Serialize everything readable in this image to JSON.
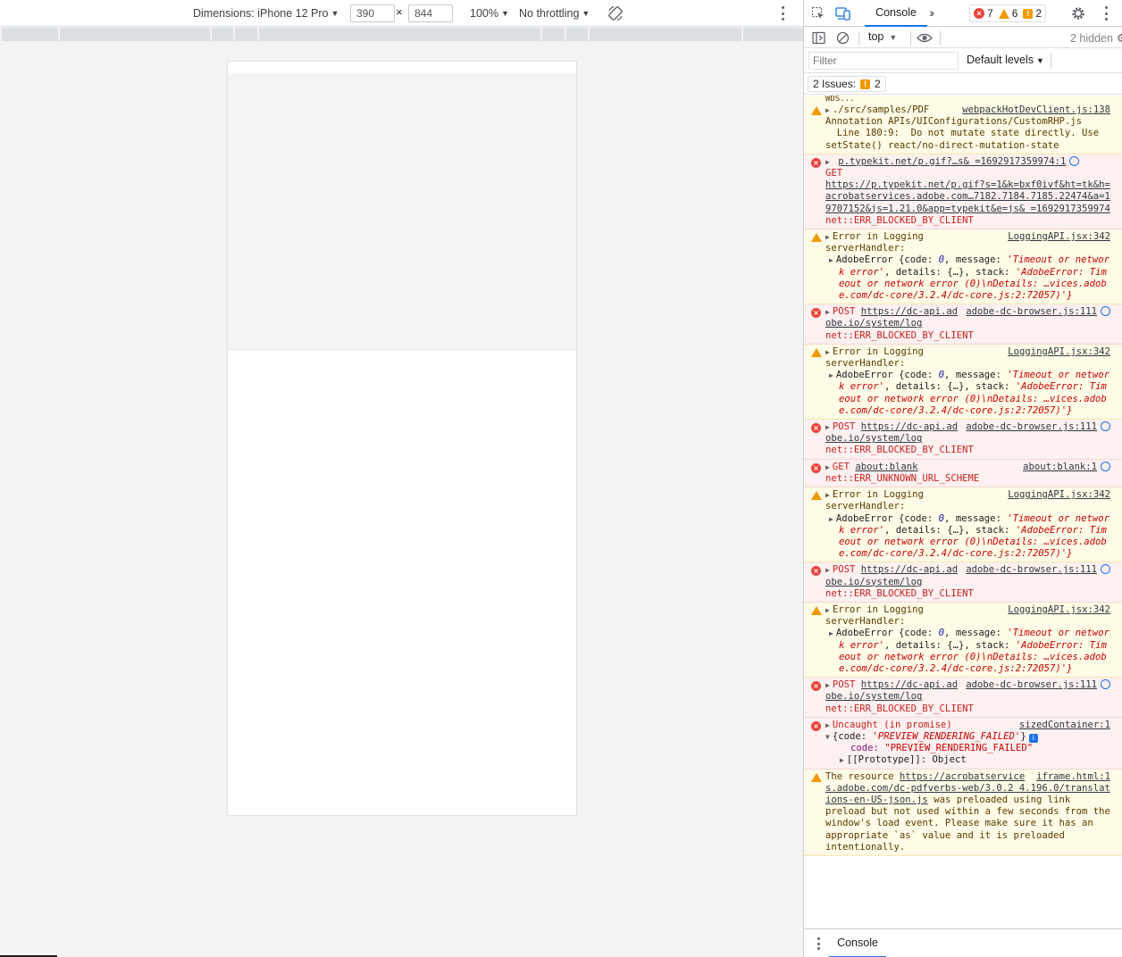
{
  "device_toolbar": {
    "dimensions_label": "Dimensions: iPhone 12 Pro",
    "width": "390",
    "height": "844",
    "zoom": "100%",
    "throttling": "No throttling"
  },
  "devtools": {
    "tab_console": "Console",
    "errors_count": "7",
    "warnings_count": "6",
    "issues_count": "2",
    "context": "top",
    "hidden_label": "2 hidden",
    "filter_placeholder": "Filter",
    "levels_label": "Default levels",
    "issues_chip_label": "2 Issues:",
    "issues_chip_count": "2",
    "drawer_tab": "Console"
  },
  "log": {
    "top_cut": "WDS...",
    "e1": {
      "source": "webpackHotDevClient.js:138",
      "l1": "./src/samples/PDF",
      "l2": "Annotation APIs/UIConfigurations/CustomRHP.js",
      "l3": "  Line 180:9:  Do not mutate state directly. Use",
      "l4": "setState()  react/no-direct-mutation-state"
    },
    "e2": {
      "source": "p.typekit.net/p.gif?…s& =1692917359974:1",
      "l1": "GET",
      "url": "https://p.typekit.net/p.gif?s=1&k=bxf0ivf&ht=tk&h=acrobatservices.adobe.com…7182.7184.7185.22474&a=19707152&js=1.21.0&app=typekit&e=js& =1692917359974",
      "code": "net::ERR_BLOCKED_BY_CLIENT"
    },
    "logging": {
      "source": "LoggingAPI.jsx:342",
      "l1": "Error in Logging",
      "l2": "serverHandler:",
      "cls": "AdobeError",
      "k_code": "code",
      "v_code": "0",
      "k_msg": "message",
      "v_msg": "'Timeout or network error'",
      "k_details": "details",
      "v_details": "{…}",
      "k_stack": "stack",
      "v_stack": "'AdobeError: Timeout or network error (0)\\nDetails: …vices.adobe.com/dc-core/3.2.4/dc-core.js:2:72057)'}"
    },
    "post": {
      "source": "adobe-dc-browser.js:111",
      "method": "POST",
      "url": "https://dc-api.adobe.io/system/log",
      "code": "net::ERR_BLOCKED_BY_CLIENT"
    },
    "blank": {
      "source": "about:blank:1",
      "method": "GET",
      "url": "about:blank",
      "code": "net::ERR_UNKNOWN_URL_SCHEME"
    },
    "uncaught": {
      "source": "sizedContainer:1",
      "l1": "Uncaught (in promise)",
      "obj_open": "{code: ",
      "obj_val": "'PREVIEW_RENDERING_FAILED'",
      "obj_close": "}",
      "k_code": "code:",
      "v_code": "\"PREVIEW_RENDERING_FAILED\"",
      "proto": "[[Prototype]]: Object"
    },
    "resource": {
      "source": "iframe.html:1",
      "pre": "The resource ",
      "url": "https://acrobatservices.adobe.com/dc-pdfverbs-web/3.0.2 4.196.0/translations-en-US-json.js",
      "post": " was preloaded using link preload but not used within a few seconds from the window's load event. Please make sure it has an appropriate `as` value and it is preloaded intentionally."
    }
  }
}
